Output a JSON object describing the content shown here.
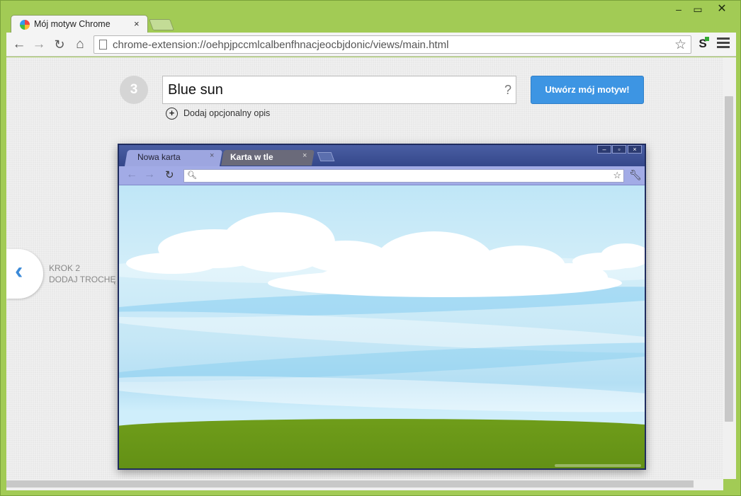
{
  "window": {
    "minimize_glyph": "–",
    "maximize_glyph": "▭",
    "close_glyph": "✕"
  },
  "tab": {
    "title": "Mój motyw Chrome",
    "close_glyph": "×"
  },
  "toolbar": {
    "url": "chrome-extension://oehpjpccmlcalbenfhnacjeocbjdonic/views/main.html",
    "extension_letter": "S"
  },
  "step": {
    "number": "3",
    "theme_name_value": "Blue sun",
    "help": "?",
    "create_button": "Utwórz mój motyw!",
    "add_description_icon": "+",
    "add_description": "Dodaj opcjonalny opis"
  },
  "previous_step": {
    "arrow": "‹",
    "line1": "KROK 2",
    "line2": "DODAJ TROCHĘ KOLORÓW"
  },
  "preview": {
    "active_tab": "Nowa karta",
    "background_tab": "Karta w tle",
    "tab_close": "×",
    "colors": {
      "frame": "#3b4d8a",
      "toolbar": "#a2abe6",
      "active_tab": "#9da6e0",
      "background_tab": "#6a6a7a",
      "sky": "#bfe6f7",
      "grass": "#6f9d1a"
    }
  },
  "colors": {
    "window_frame": "#a2cb55",
    "accent_button": "#3d95e3",
    "page_background": "#ececec"
  }
}
